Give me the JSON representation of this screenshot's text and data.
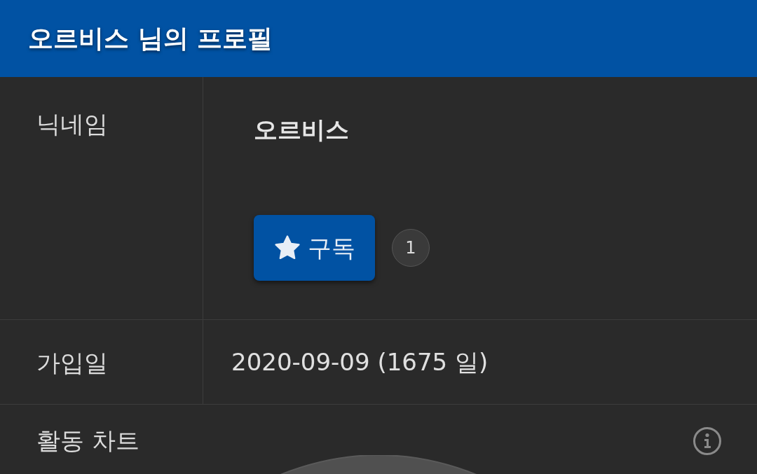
{
  "header": {
    "title": "오르비스 님의 프로필"
  },
  "profile": [
    {
      "kind": "nickname",
      "label": "닉네임",
      "value": "오르비스",
      "subscribe_button": "구독",
      "subscriber_count": "1"
    },
    {
      "kind": "joined",
      "label": "가입일",
      "value": "2020-09-09 (1675 일)"
    }
  ],
  "activity_chart": {
    "title": "활동 차트"
  }
}
